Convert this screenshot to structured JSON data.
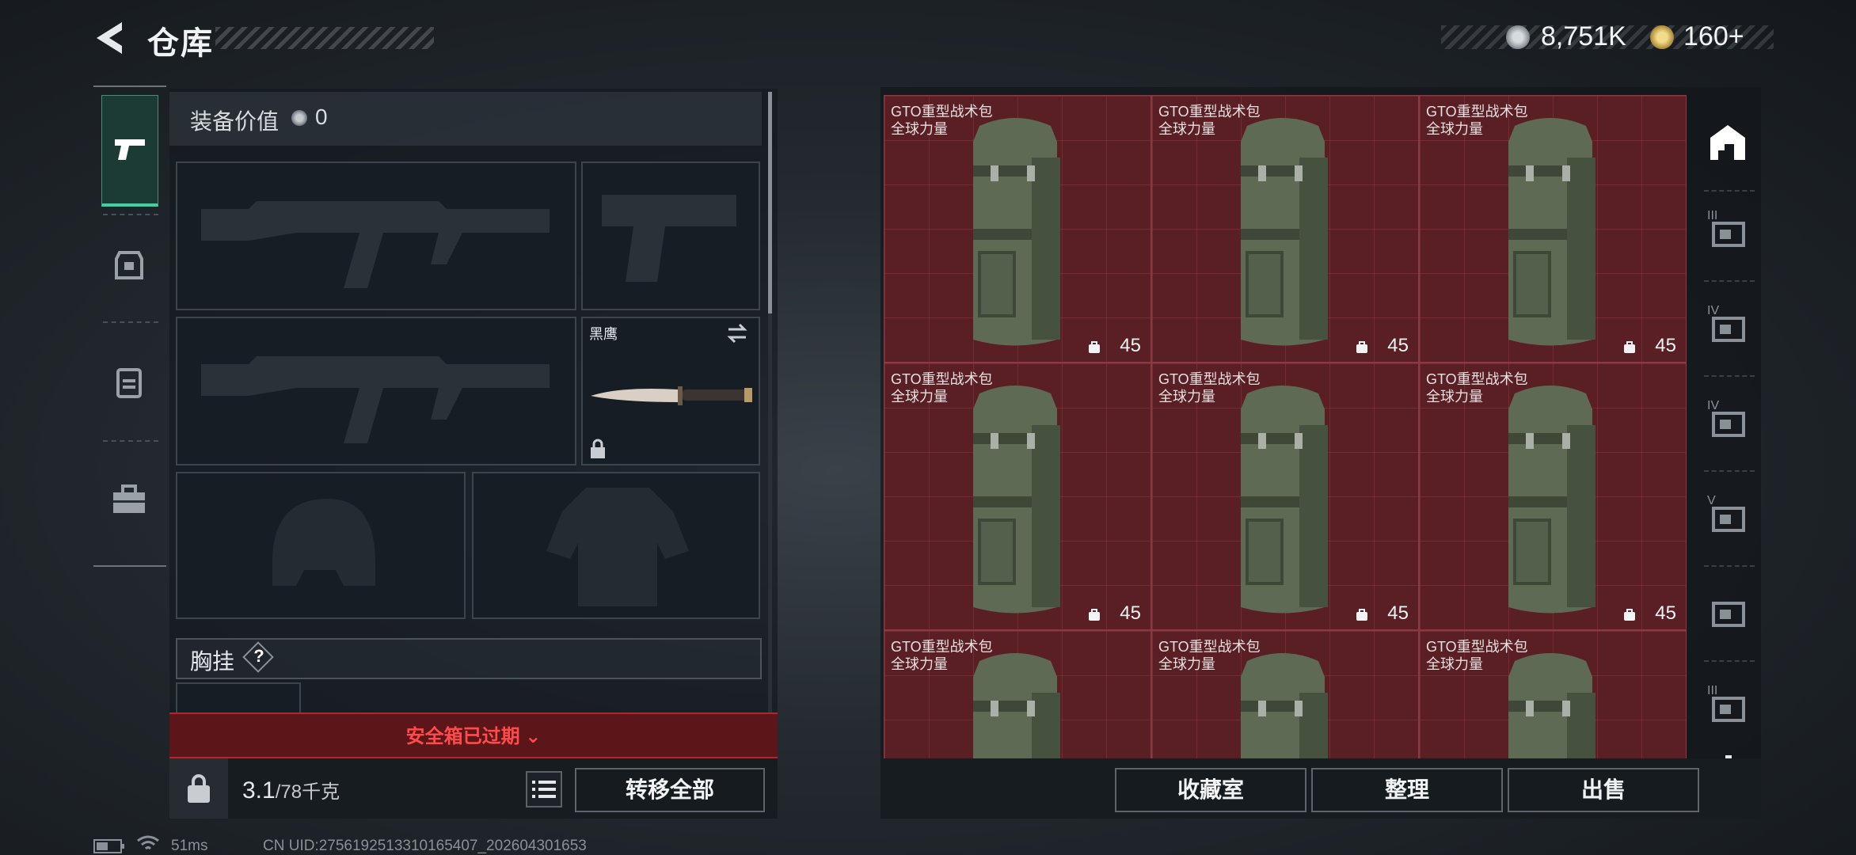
{
  "header": {
    "title": "仓库",
    "currency_1": "8,751K",
    "currency_2": "160+"
  },
  "equipment": {
    "value_label": "装备价值",
    "value": "0",
    "knife_name": "黑鹰",
    "chest_label": "胸挂",
    "chest_help": "?"
  },
  "safe_box": {
    "label": "安全箱已过期"
  },
  "load": {
    "current": "3.1",
    "capacity": "/78千克",
    "transfer_all": "转移全部"
  },
  "storage": {
    "items": [
      {
        "name": "GTO重型战术包",
        "tag": "全球力量",
        "capacity": "45"
      },
      {
        "name": "GTO重型战术包",
        "tag": "全球力量",
        "capacity": "45"
      },
      {
        "name": "GTO重型战术包",
        "tag": "全球力量",
        "capacity": "45"
      },
      {
        "name": "GTO重型战术包",
        "tag": "全球力量",
        "capacity": "45"
      },
      {
        "name": "GTO重型战术包",
        "tag": "全球力量",
        "capacity": "45"
      },
      {
        "name": "GTO重型战术包",
        "tag": "全球力量",
        "capacity": "45"
      },
      {
        "name": "GTO重型战术包",
        "tag": "全球力量",
        "capacity": ""
      },
      {
        "name": "GTO重型战术包",
        "tag": "全球力量",
        "capacity": ""
      },
      {
        "name": "GTO重型战术包",
        "tag": "全球力量",
        "capacity": ""
      }
    ],
    "buttons": {
      "collection": "收藏室",
      "sort": "整理",
      "sell": "出售"
    },
    "right_tabs": [
      "III",
      "IV",
      "IV",
      "V",
      "",
      "III"
    ]
  },
  "status_bar": {
    "ping": "51ms",
    "uid": "CN UID:2756192513310165407_202604301653"
  },
  "colors": {
    "accent": "#3fd0a0",
    "danger": "#ff4b4b",
    "cell": "#5a1e25"
  }
}
